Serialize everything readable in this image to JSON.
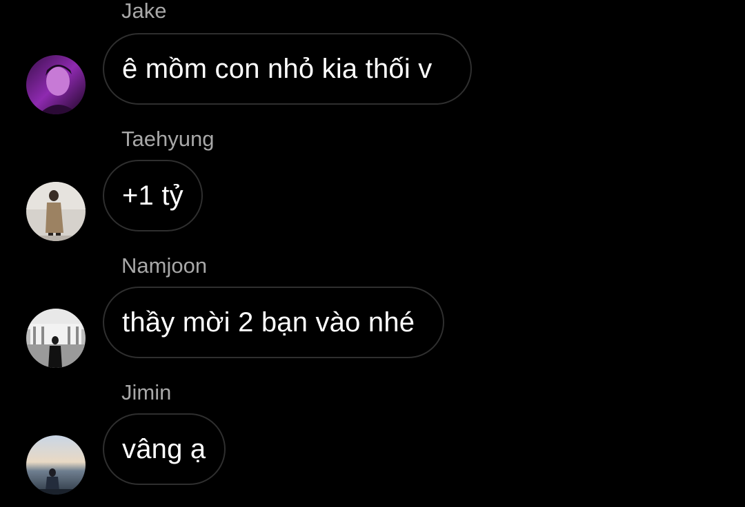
{
  "messages": [
    {
      "sender": "Jake",
      "text": "ê mồm con nhỏ kia thối v",
      "avatar": "jake-avatar"
    },
    {
      "sender": "Taehyung",
      "text": "+1 tỷ",
      "avatar": "taehyung-avatar"
    },
    {
      "sender": "Namjoon",
      "text": "thầy mời 2 bạn vào nhé",
      "avatar": "namjoon-avatar"
    },
    {
      "sender": "Jimin",
      "text": "vâng ạ",
      "avatar": "jimin-avatar"
    }
  ],
  "colors": {
    "background": "#000000",
    "sender_name": "#a8a8a8",
    "bubble_border": "#2f2f2f",
    "message_text": "#ffffff"
  }
}
